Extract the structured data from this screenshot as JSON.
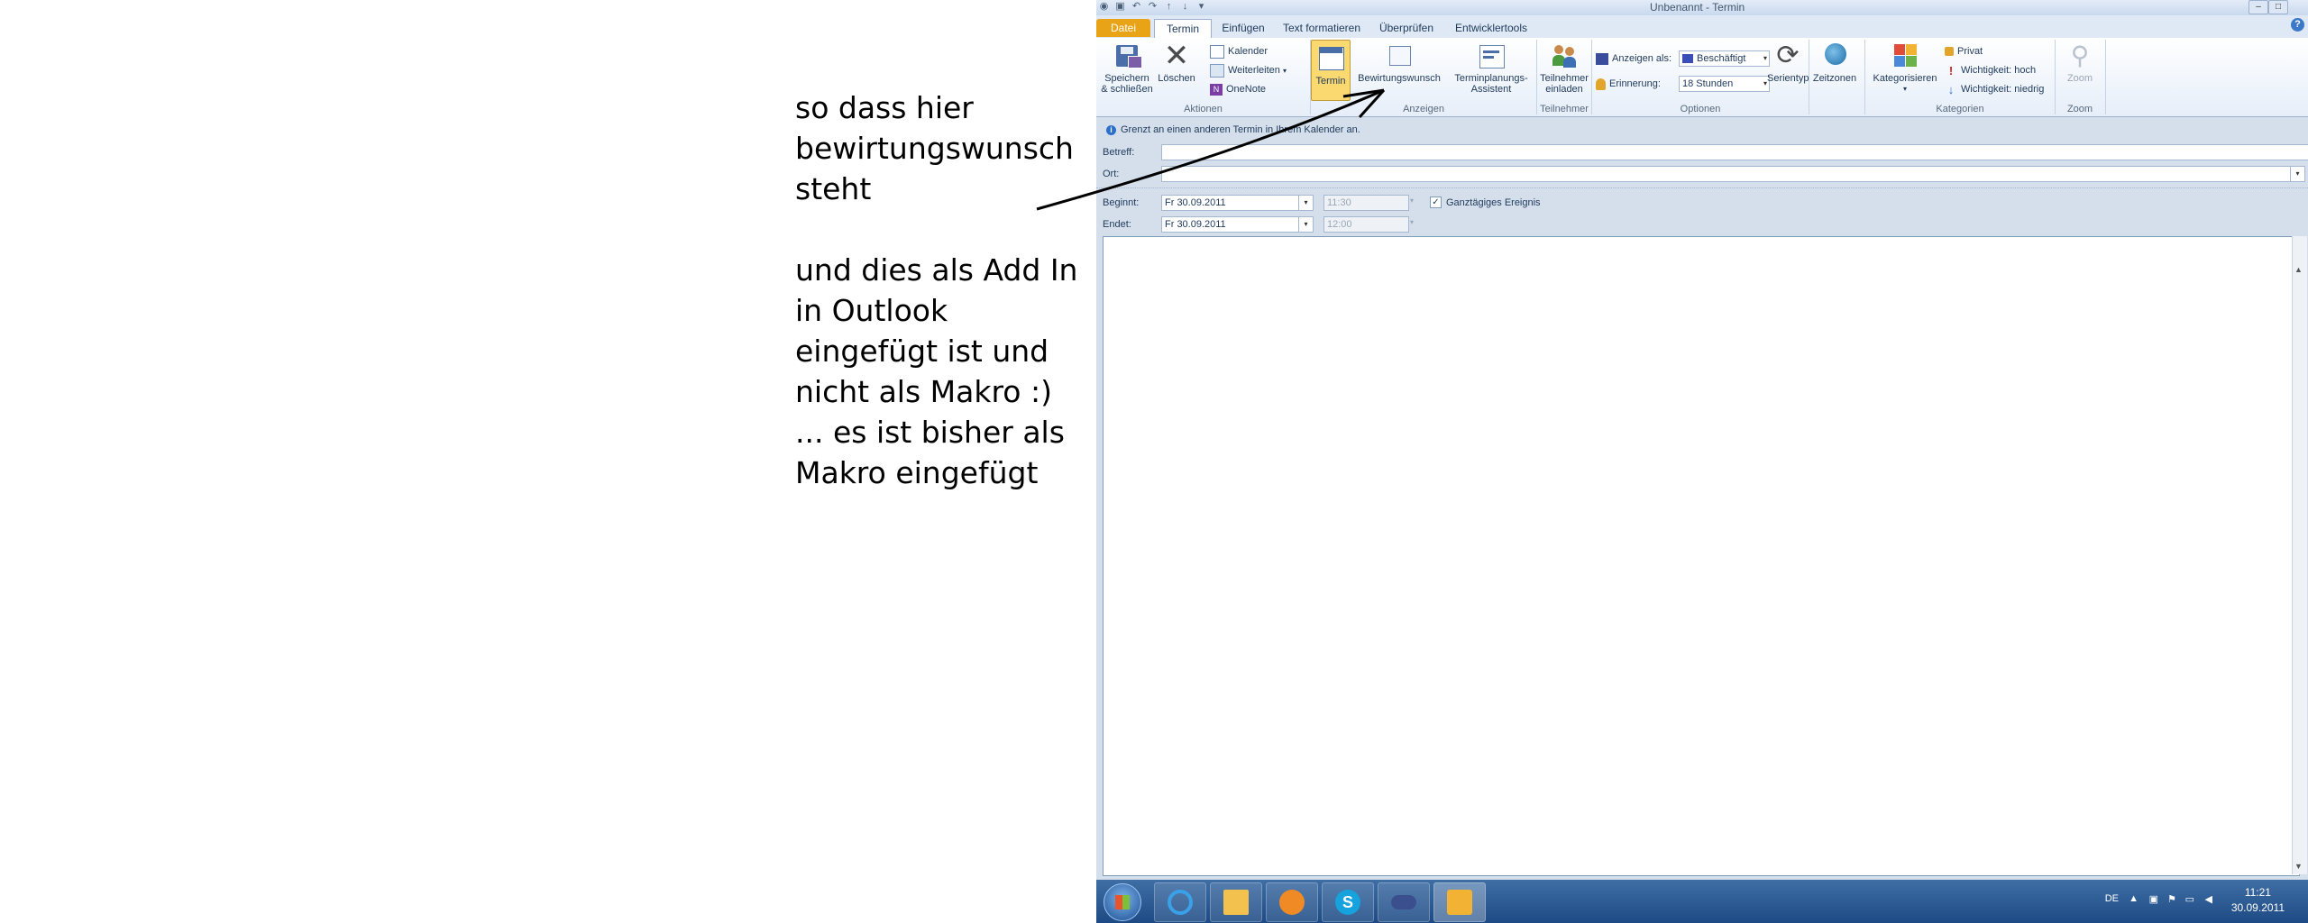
{
  "annotation": {
    "lines_top": [
      "so dass hier",
      "bewirtungswunsch",
      "steht"
    ],
    "lines_bottom": [
      "und dies als Add In",
      "in Outlook",
      "eingefügt ist und",
      "nicht als Makro :)",
      "... es ist bisher als",
      "Makro eingefügt"
    ]
  },
  "window": {
    "title": "Unbenannt - Termin",
    "tabs": [
      "Datei",
      "Termin",
      "Einfügen",
      "Text formatieren",
      "Überprüfen",
      "Entwicklertools"
    ],
    "help_icon": "help-icon"
  },
  "ribbon": {
    "aktionen": {
      "label": "Aktionen",
      "save_close": [
        "Speichern",
        "& schließen"
      ],
      "delete": "Löschen",
      "calendar": "Kalender",
      "forward": "Weiterleiten",
      "onenote": "OneNote"
    },
    "anzeigen": {
      "label": "Anzeigen",
      "termin": "Termin",
      "bewirtungswunsch": "Bewirtungswunsch",
      "assistant": [
        "Terminplanungs-",
        "Assistent"
      ]
    },
    "teilnehmer": {
      "label": "Teilnehmer",
      "invite": [
        "Teilnehmer",
        "einladen"
      ]
    },
    "optionen": {
      "label": "Optionen",
      "show_as_label": "Anzeigen als:",
      "show_as_value": "Beschäftigt",
      "reminder_label": "Erinnerung:",
      "reminder_value": "18 Stunden",
      "recurrence": "Serientyp",
      "timezones": "Zeitzonen"
    },
    "kategorien": {
      "label": "Kategorien",
      "categorize": "Kategorisieren",
      "private": "Privat",
      "importance_high": "Wichtigkeit: hoch",
      "importance_low": "Wichtigkeit: niedrig"
    },
    "zoom": {
      "label": "Zoom",
      "zoom": "Zoom"
    }
  },
  "form": {
    "info": "Grenzt an einen anderen Termin in Ihrem Kalender an.",
    "subject_label": "Betreff:",
    "subject_value": "",
    "location_label": "Ort:",
    "location_value": "",
    "start_label": "Beginnt:",
    "start_date": "Fr 30.09.2011",
    "start_time": "11:30",
    "end_label": "Endet:",
    "end_date": "Fr 30.09.2011",
    "end_time": "12:00",
    "allday_label": "Ganztägiges Ereignis",
    "allday_checked": true
  },
  "taskbar": {
    "language": "DE",
    "time": "11:21",
    "date": "30.09.2011"
  },
  "colors": {
    "datei_tab": "#e8a317",
    "taskbar": "#2a5a95",
    "active_button": "#fbd971"
  }
}
